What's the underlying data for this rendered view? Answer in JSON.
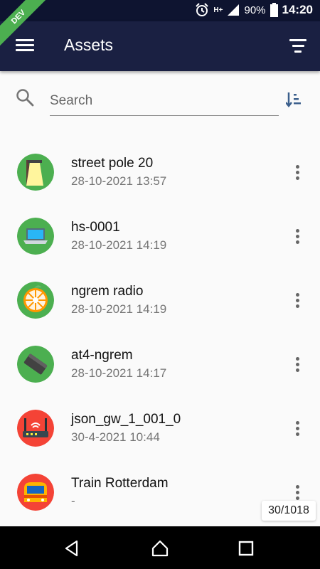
{
  "status_bar": {
    "battery": "90%",
    "time": "14:20",
    "network": "H+"
  },
  "ribbon": {
    "label": "DEV"
  },
  "app_bar": {
    "title": "Assets"
  },
  "search": {
    "placeholder": "Search"
  },
  "assets": [
    {
      "name": "street pole 20",
      "date": "28-10-2021 13:57",
      "icon": "street-pole-icon",
      "status_color": "#4caf50"
    },
    {
      "name": "hs-0001",
      "date": "28-10-2021 14:19",
      "icon": "laptop-icon",
      "status_color": "#4caf50"
    },
    {
      "name": "ngrem radio",
      "date": "28-10-2021 14:19",
      "icon": "orange-slice-icon",
      "status_color": "#4caf50"
    },
    {
      "name": "at4-ngrem",
      "date": "28-10-2021 14:17",
      "icon": "gateway-device-icon",
      "status_color": "#4caf50"
    },
    {
      "name": "json_gw_1_001_0",
      "date": "30-4-2021 10:44",
      "icon": "router-icon",
      "status_color": "#f44336"
    },
    {
      "name": "Train Rotterdam",
      "date": "-",
      "icon": "train-icon",
      "status_color": "#f44336"
    }
  ],
  "pagination": {
    "counter": "30/1018"
  }
}
